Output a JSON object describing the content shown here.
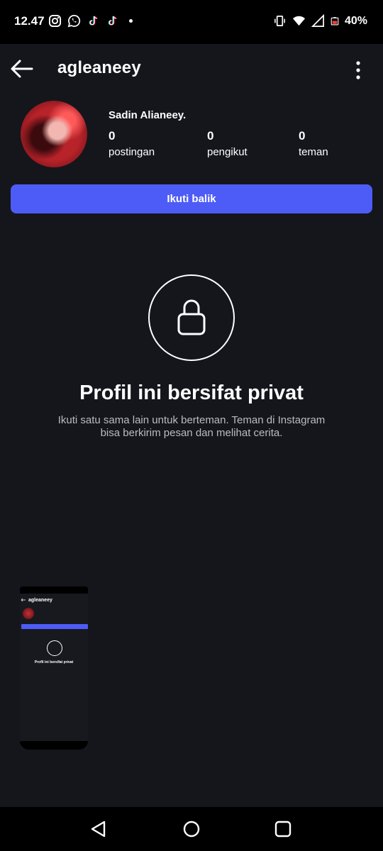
{
  "status_bar": {
    "time": "12.47",
    "battery": "40%",
    "icons_left": [
      "instagram-icon",
      "whatsapp-icon",
      "tiktok-icon",
      "tiktok-icon",
      "notification-dot"
    ],
    "icons_right": [
      "vibrate-icon",
      "wifi-icon",
      "signal-icon",
      "battery-icon"
    ]
  },
  "header": {
    "username": "agleaneey"
  },
  "profile": {
    "display_name": "Sadin Alianeey.",
    "stats": [
      {
        "value": "0",
        "label": "postingan"
      },
      {
        "value": "0",
        "label": "pengikut"
      },
      {
        "value": "0",
        "label": "teman"
      }
    ]
  },
  "actions": {
    "follow_back_label": "Ikuti balik"
  },
  "private_notice": {
    "title": "Profil ini bersifat privat",
    "description": "Ikuti satu sama lain untuk berteman. Teman di Instagram bisa berkirim pesan dan melihat cerita."
  },
  "thumbnail": {
    "username": "agleaneey",
    "title": "Profil ini bersifat privat"
  },
  "colors": {
    "background": "#14161c",
    "accent": "#4d5cf6",
    "muted_text": "#b9bcc3"
  }
}
